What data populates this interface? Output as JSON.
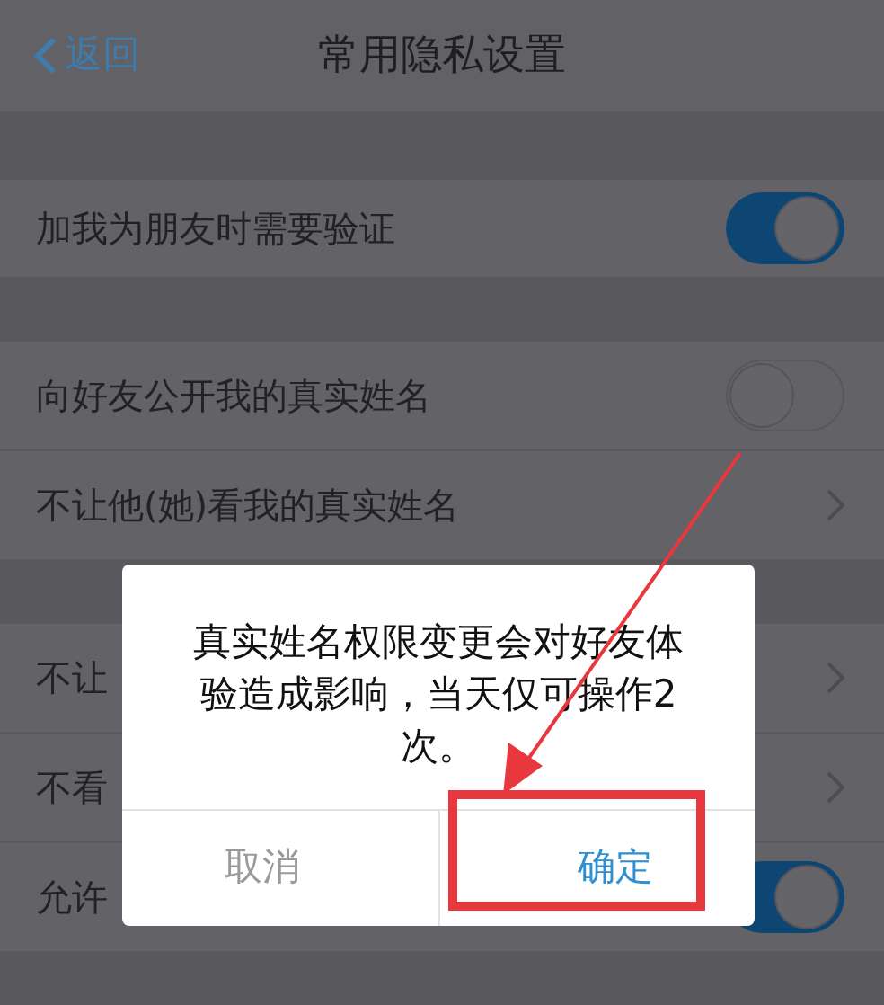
{
  "nav": {
    "back": "返回",
    "title": "常用隐私设置"
  },
  "sections": [
    {
      "rows": [
        {
          "kind": "toggle",
          "label": "加我为朋友时需要验证",
          "on": true
        }
      ]
    },
    {
      "rows": [
        {
          "kind": "toggle",
          "label": "向好友公开我的真实姓名",
          "on": false
        },
        {
          "kind": "link",
          "label": "不让他(她)看我的真实姓名"
        }
      ]
    },
    {
      "rows": [
        {
          "kind": "link",
          "label": "不让"
        },
        {
          "kind": "link",
          "label": "不看"
        },
        {
          "kind": "toggle",
          "label": "允许",
          "on": true
        }
      ]
    }
  ],
  "dialog": {
    "message": "真实姓名权限变更会对好友体验造成影响，当天仅可操作2次。",
    "buttons": [
      {
        "label": "取消",
        "primary": false
      },
      {
        "label": "确定",
        "primary": true
      }
    ]
  }
}
